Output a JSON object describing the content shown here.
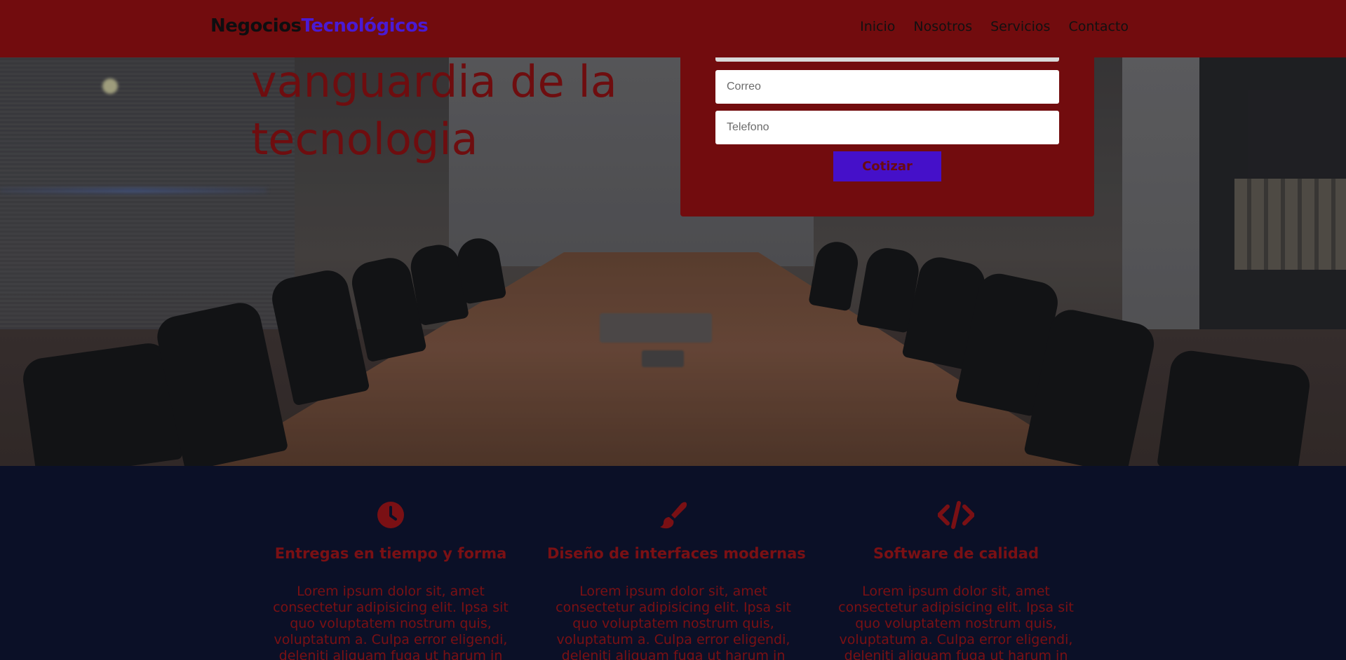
{
  "header": {
    "logo_part1": "Negocios",
    "logo_part2": "Tecnológicos",
    "nav": [
      "Inicio",
      "Nosotros",
      "Servicios",
      "Contacto"
    ]
  },
  "hero": {
    "title": "vanguardia de la tecnologia",
    "form": {
      "field_top_placeholder": "",
      "email_placeholder": "Correo",
      "phone_placeholder": "Telefono",
      "submit_label": "Cotizar"
    }
  },
  "features": [
    {
      "icon": "clock-icon",
      "title": "Entregas en tiempo y forma",
      "text": "Lorem ipsum dolor sit, amet consectetur adipisicing elit. Ipsa sit quo voluptatem nostrum quis, voluptatum a. Culpa error eligendi, deleniti aliquam fuga ut harum in"
    },
    {
      "icon": "paintbrush-icon",
      "title": "Diseño de interfaces modernas",
      "text": "Lorem ipsum dolor sit, amet consectetur adipisicing elit. Ipsa sit quo voluptatem nostrum quis, voluptatum a. Culpa error eligendi, deleniti aliquam fuga ut harum in"
    },
    {
      "icon": "code-icon",
      "title": "Software de calidad",
      "text": "Lorem ipsum dolor sit, amet consectetur adipisicing elit. Ipsa sit quo voluptatem nostrum quis, voluptatum a. Culpa error eligendi, deleniti aliquam fuga ut harum in"
    }
  ],
  "colors": {
    "header_bg": "#720c0e",
    "brand_accent": "#4a1ad3",
    "feature_text": "#7a1014",
    "features_bg": "#0b1027",
    "button_bg": "#4510c9"
  }
}
